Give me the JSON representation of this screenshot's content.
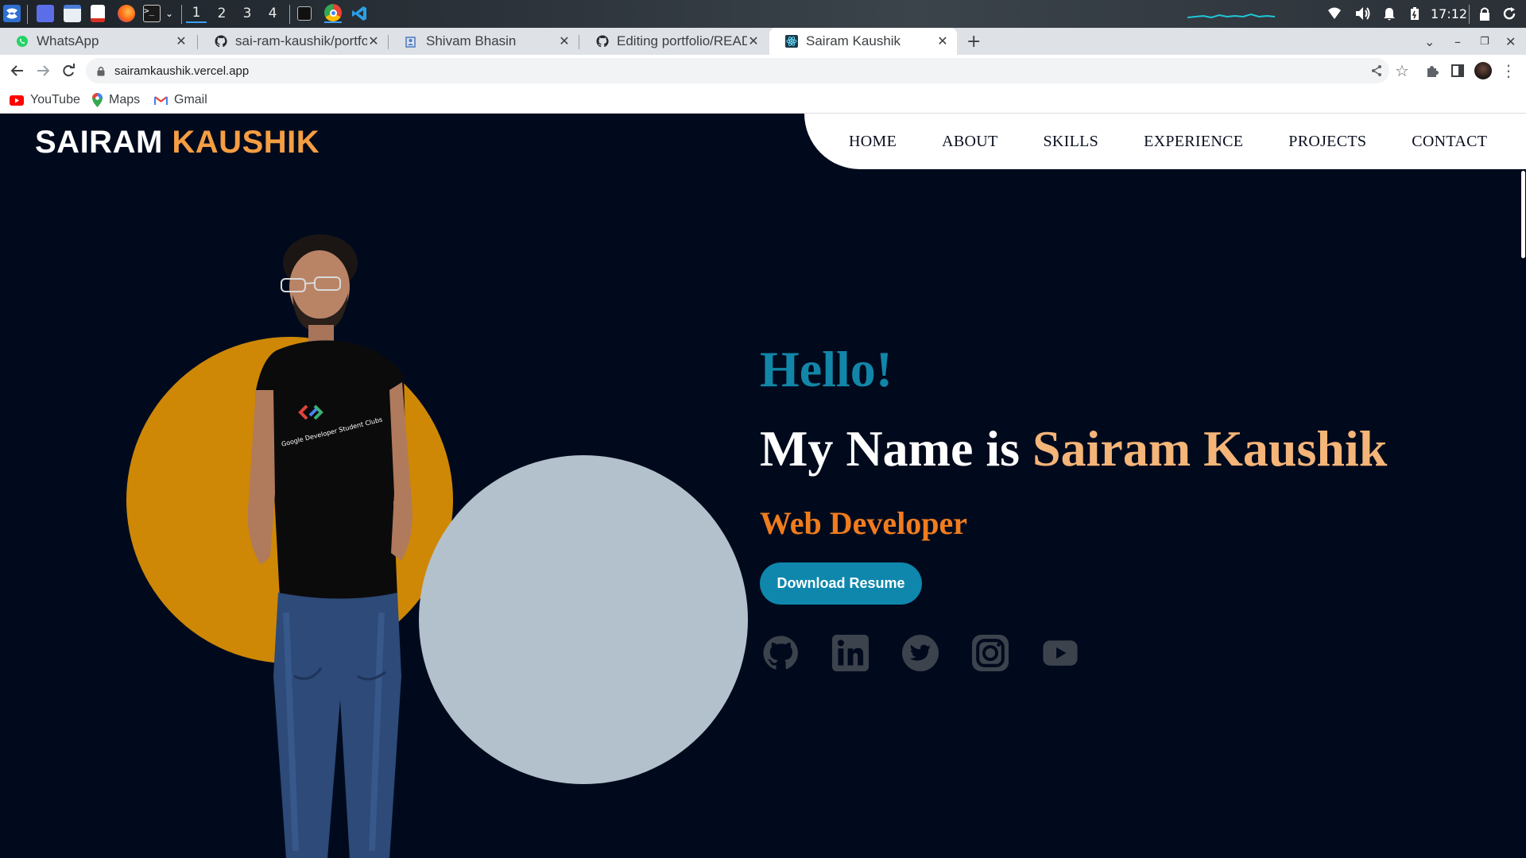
{
  "taskbar": {
    "workspaces": [
      "1",
      "2",
      "3",
      "4"
    ],
    "clock": "17:12"
  },
  "browser": {
    "tabs": [
      {
        "title": "WhatsApp",
        "icon": "whatsapp-icon"
      },
      {
        "title": "sai-ram-kaushik/portfolio",
        "icon": "github-icon"
      },
      {
        "title": "Shivam Bhasin",
        "icon": "profile-icon"
      },
      {
        "title": "Editing portfolio/README",
        "icon": "github-icon"
      },
      {
        "title": "Sairam Kaushik",
        "icon": "react-icon",
        "active": true
      }
    ],
    "new_tab": "+",
    "url": "sairamkaushik.vercel.app",
    "bookmarks": [
      {
        "label": "YouTube",
        "icon": "youtube-icon"
      },
      {
        "label": "Maps",
        "icon": "maps-icon"
      },
      {
        "label": "Gmail",
        "icon": "gmail-icon"
      }
    ]
  },
  "site": {
    "logo_first": "SAIRAM",
    "logo_second": "KAUSHIK",
    "nav": [
      "HOME",
      "ABOUT",
      "SKILLS",
      "EXPERIENCE",
      "PROJECTS",
      "CONTACT"
    ],
    "hero": {
      "greeting": "Hello!",
      "name_prefix": "My Name is ",
      "name": "Sairam Kaushik",
      "role": "Web Developer",
      "cta": "Download Resume"
    },
    "socials": [
      "github-icon",
      "linkedin-icon",
      "twitter-icon",
      "instagram-icon",
      "youtube-icon"
    ],
    "colors": {
      "background": "#010a1d",
      "accent_orange": "#f59e42",
      "teal": "#1286a8",
      "circle_orange": "#ce8806",
      "circle_gray": "#b3c1cc",
      "social_icons": "#3d434d"
    }
  }
}
